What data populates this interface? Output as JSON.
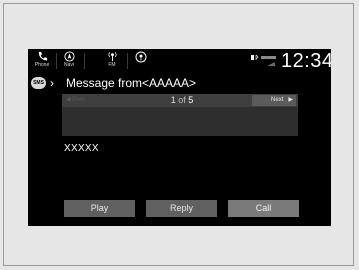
{
  "statusbar": {
    "phone_label": "Phone",
    "navi_label": "Navi",
    "fm_label": "FM",
    "time": "12:34"
  },
  "header": {
    "sms_badge": "SMS",
    "title": "Message from<AAAAA>"
  },
  "pager": {
    "prev_label": "Prev",
    "current": "1",
    "of": "of",
    "total": "5",
    "next_label": "Next"
  },
  "message": {
    "body": "XXXXX"
  },
  "actions": {
    "play_label": "Play",
    "reply_label": "Reply",
    "call_label": "Call"
  },
  "colors": {
    "screen_bg": "#000000",
    "button_bg": "#606060",
    "panel_bg": "#2e2e2e"
  }
}
